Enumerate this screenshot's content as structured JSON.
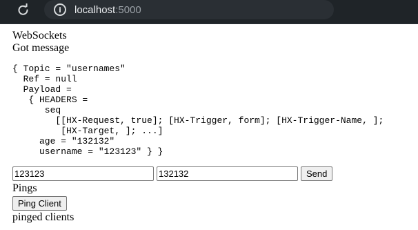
{
  "browser": {
    "url_host": "localhost",
    "url_port": ":5000",
    "icons": {
      "reload": "reload-icon",
      "info": "info-icon"
    }
  },
  "page": {
    "heading": "WebSockets",
    "status": "Got message",
    "message_lines": [
      "{ Topic = \"usernames\"",
      "  Ref = null",
      "  Payload =",
      "   { HEADERS =",
      "      seq",
      "        [[HX-Request, true]; [HX-Trigger, form]; [HX-Trigger-Name, ];",
      "         [HX-Target, ]; ...]",
      "     age = \"132132\"",
      "     username = \"123123\" } }"
    ],
    "form": {
      "username_value": "123123",
      "age_value": "132132",
      "send_label": "Send"
    },
    "pings": {
      "title": "Pings",
      "button_label": "Ping Client",
      "result": "pinged clients"
    }
  }
}
